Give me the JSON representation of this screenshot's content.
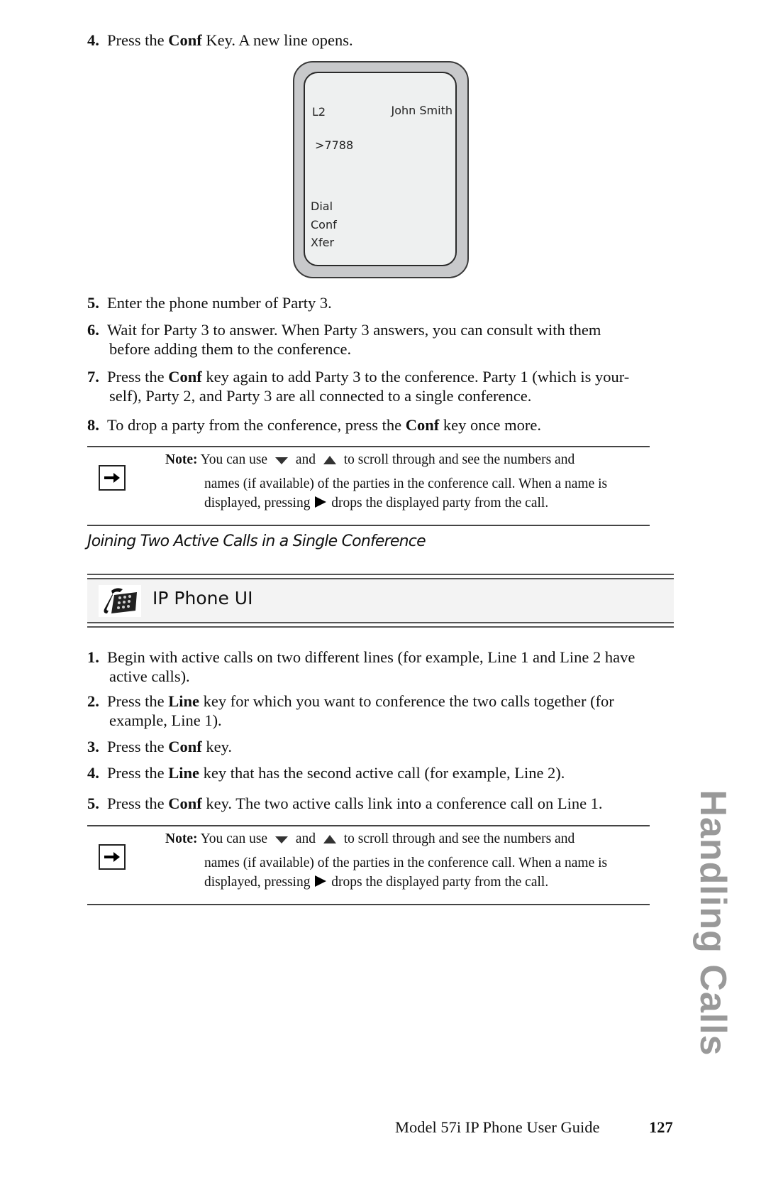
{
  "steps_a": [
    {
      "num": "4.",
      "pre": "Press the ",
      "bold": "Conf",
      "post": " Key. A new line opens."
    },
    {
      "num": "5.",
      "text": "Enter the phone number of Party 3."
    },
    {
      "num": "6.",
      "line1": "Wait for Party 3 to answer. When Party 3 answers, you can consult with them",
      "line2": "before adding them to the conference."
    },
    {
      "num": "7.",
      "pre": "Press the ",
      "bold": "Conf",
      "post": " key again to add Party 3 to the conference. Party 1 (which is your-",
      "line2": "self), Party 2, and Party 3 are all connected to a single conference."
    },
    {
      "num": "8.",
      "pre": "To drop a party from the conference, press the ",
      "bold": "Conf",
      "post": " key once more."
    }
  ],
  "phone_display": {
    "line_label": "L2",
    "caller_name": "John Smith",
    "dialed": ">7788",
    "softkeys": [
      "Dial",
      "Conf",
      "Xfer"
    ]
  },
  "note": {
    "label": "Note:",
    "part1": " You can use ",
    "and": " and ",
    "part2": " to scroll through and see the numbers and",
    "line2": "names (if available) of the parties in the conference call. When a name is",
    "line3_pre": "displayed, pressing ",
    "line3_post": " drops the displayed party from the call."
  },
  "section_heading": "Joining Two Active Calls in a Single Conference",
  "ui_header": {
    "title": "IP Phone UI",
    "icon": "desk-phone-icon"
  },
  "steps_b": [
    {
      "num": "1.",
      "line1": "Begin with active calls on two different lines (for example, Line 1 and Line 2 have",
      "line2": "active calls)."
    },
    {
      "num": "2.",
      "pre": "Press the ",
      "bold": "Line",
      "post": " key for which you want to conference the two calls together (for",
      "line2": "example, Line 1)."
    },
    {
      "num": "3.",
      "pre": "Press the ",
      "bold": "Conf",
      "post": " key."
    },
    {
      "num": "4.",
      "pre": "Press the ",
      "bold": "Line",
      "post": " key that has the second active call (for example, Line 2)."
    },
    {
      "num": "5.",
      "pre": "Press the ",
      "bold": "Conf",
      "post": " key. The two active calls link into a conference call on Line 1."
    }
  ],
  "side_tab": "Handling Calls",
  "footer": {
    "guide_title": "Model 57i IP Phone User Guide",
    "page_number": "127"
  }
}
